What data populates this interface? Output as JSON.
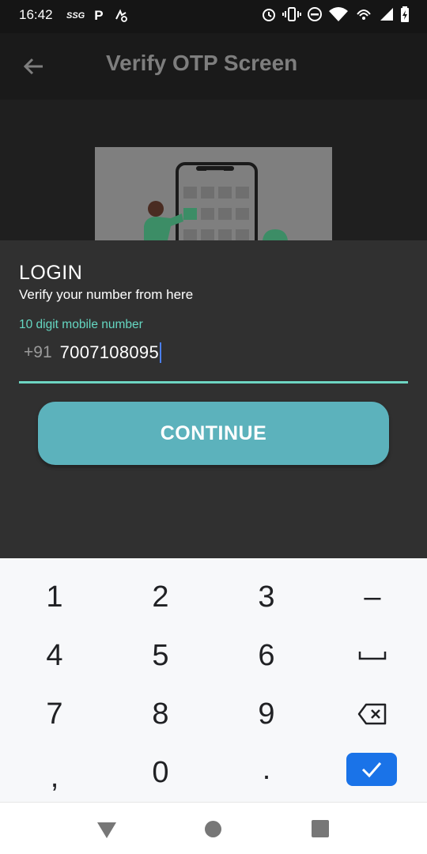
{
  "status_bar": {
    "time": "16:42",
    "carrier_tag": "SSG",
    "parking_tag": "P",
    "icons": [
      "sync-icon",
      "alarm-icon",
      "vibrate-icon",
      "do-not-disturb-icon",
      "wifi-icon",
      "hotspot-icon",
      "signal-icon",
      "battery-icon"
    ]
  },
  "app_bar": {
    "title": "Verify OTP Screen",
    "back_icon": "arrow-left-icon"
  },
  "login": {
    "title": "LOGIN",
    "subtitle": "Verify your number from here",
    "field_label": "10 digit mobile number",
    "country_code": "+91",
    "phone_value": "7007108095",
    "continue_label": "CONTINUE"
  },
  "keypad": {
    "keys": {
      "k1": "1",
      "k2": "2",
      "k3": "3",
      "dash": "–",
      "k4": "4",
      "k5": "5",
      "k6": "6",
      "k7": "7",
      "k8": "8",
      "k9": "9",
      "comma": ",",
      "k0": "0",
      "dot": "."
    }
  },
  "colors": {
    "accent_teal": "#5cb2bc",
    "label_teal": "#65d7c2",
    "sheet_bg": "#303030",
    "keypad_done_blue": "#1a73e8"
  }
}
